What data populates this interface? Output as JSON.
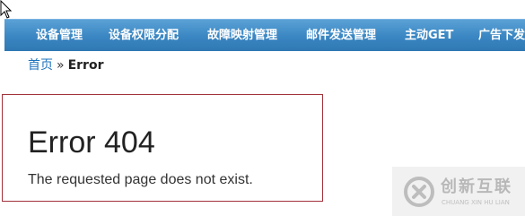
{
  "nav": {
    "items": [
      {
        "label": "设备管理"
      },
      {
        "label": "设备权限分配"
      },
      {
        "label": "故障映射管理"
      },
      {
        "label": "邮件发送管理"
      },
      {
        "label": "主动GET"
      },
      {
        "label": "广告下发"
      }
    ]
  },
  "breadcrumb": {
    "home": "首页",
    "separator": "»",
    "current": "Error"
  },
  "error": {
    "title": "Error 404",
    "message": "The requested page does not exist."
  },
  "watermark": {
    "text_cn": "创新互联",
    "text_en": "CHUANG XIN HU LIAN"
  },
  "colors": {
    "navbar": "#3a86c2",
    "link": "#1e73be",
    "error_border": "#a1303a"
  },
  "icons": {
    "cursor": "mouse-pointer-icon",
    "watermark_logo": "brand-logo-icon"
  }
}
